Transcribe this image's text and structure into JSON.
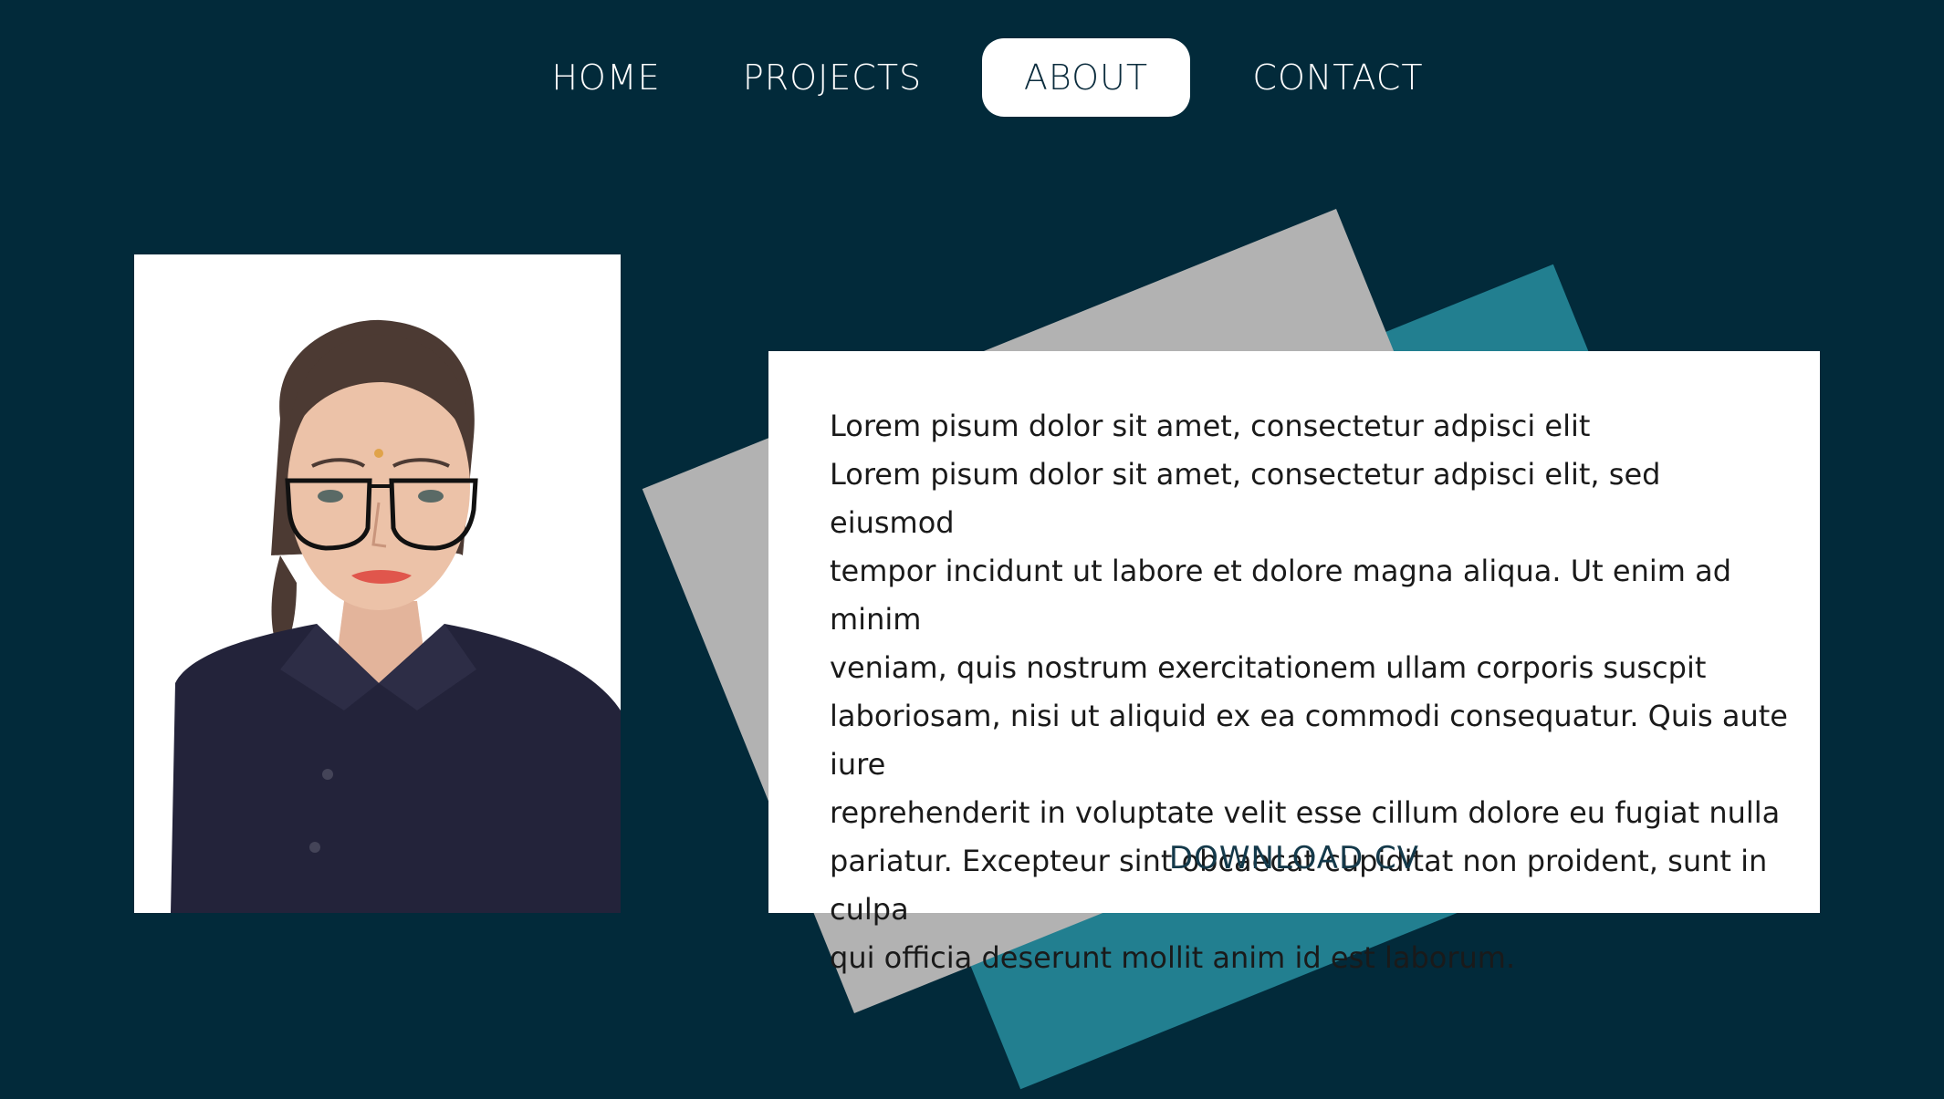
{
  "nav": {
    "items": [
      {
        "label": "HOME"
      },
      {
        "label": "PROJECTS"
      },
      {
        "label": "ABOUT",
        "active": true
      },
      {
        "label": "CONTACT"
      }
    ]
  },
  "about": {
    "heading_line": "Lorem pisum dolor sit amet, consectetur adpisci elit",
    "body_lines": [
      "Lorem pisum dolor sit amet, consectetur adpisci elit, sed eiusmod",
      "tempor incidunt ut labore et dolore magna aliqua. Ut enim ad minim",
      "veniam, quis nostrum exercitationem ullam corporis suscpit",
      "laboriosam, nisi ut aliquid ex ea commodi consequatur. Quis aute iure",
      "reprehenderit in voluptate velit esse cillum dolore eu fugiat nulla",
      "pariatur. Excepteur sint obcaecat cupiditat non proident, sunt in culpa",
      "qui officia deserunt mollit anim id est laborum."
    ],
    "download_label": "DOWNLOAD CV"
  },
  "colors": {
    "background": "#022a3a",
    "accent_teal": "#227f90",
    "accent_gray": "#b2b2b2",
    "card": "#ffffff"
  }
}
